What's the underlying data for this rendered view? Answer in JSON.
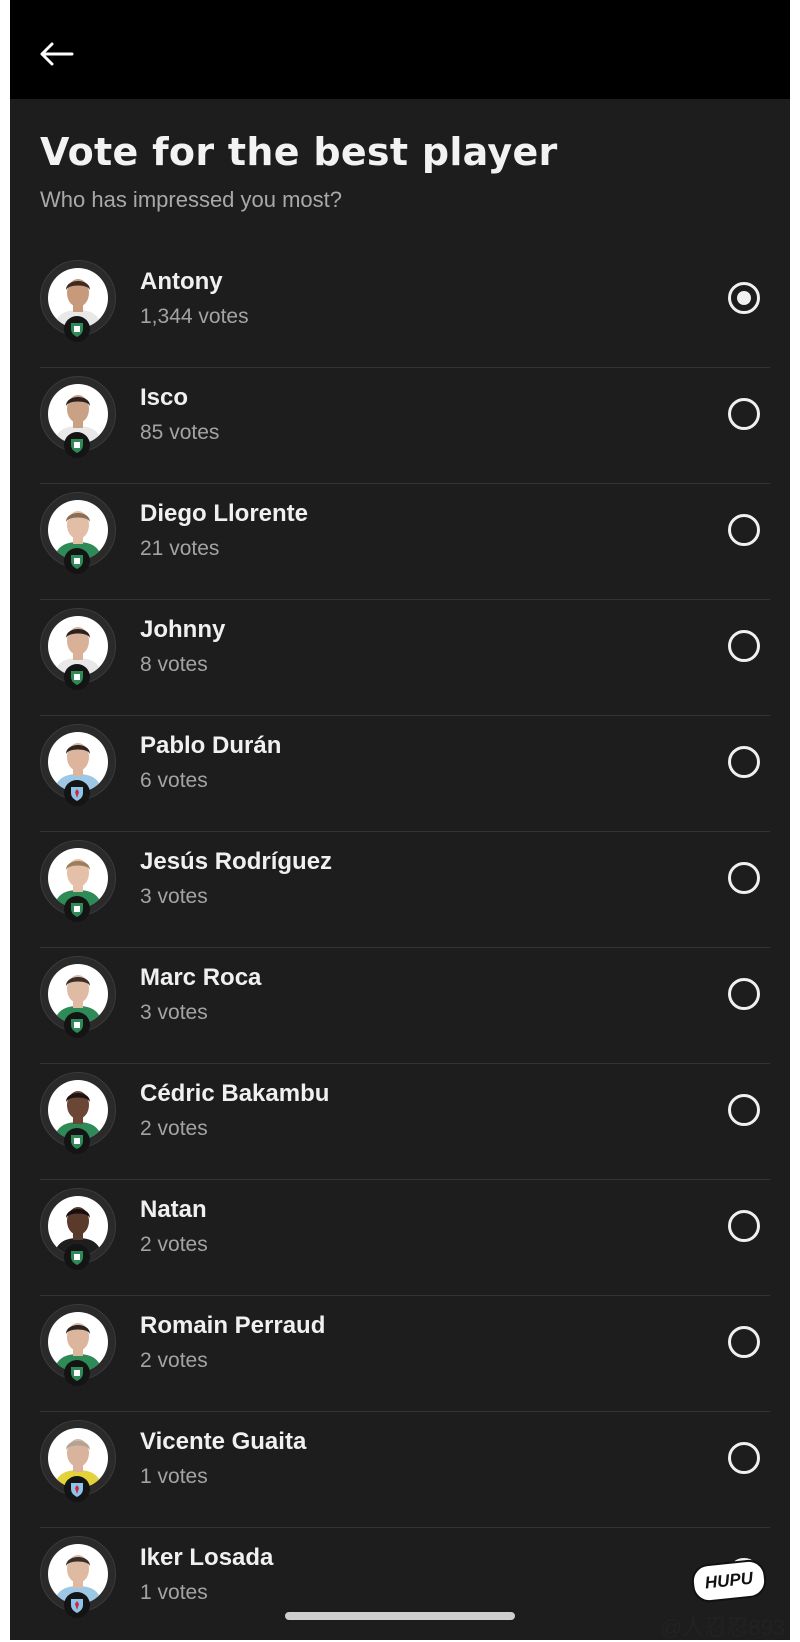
{
  "header": {
    "back_icon": "arrow-left-icon"
  },
  "poll": {
    "title": "Vote for the best player",
    "subtitle": "Who has impressed you most?"
  },
  "players": [
    {
      "name": "Antony",
      "votes": "1,344 votes",
      "selected": true,
      "skin": "#c89a7c",
      "hair": "#3b2b22",
      "shirt": "#e8e8e8",
      "team": "betis"
    },
    {
      "name": "Isco",
      "votes": "85 votes",
      "selected": false,
      "skin": "#c9a184",
      "hair": "#2b2220",
      "shirt": "#e8e8e8",
      "team": "betis"
    },
    {
      "name": "Diego Llorente",
      "votes": "21 votes",
      "selected": false,
      "skin": "#e2bea6",
      "hair": "#8a6d55",
      "shirt": "#2e8b57",
      "team": "betis"
    },
    {
      "name": "Johnny",
      "votes": "8 votes",
      "selected": false,
      "skin": "#d8b198",
      "hair": "#2a2220",
      "shirt": "#e8e8e8",
      "team": "betis"
    },
    {
      "name": "Pablo Durán",
      "votes": "6 votes",
      "selected": false,
      "skin": "#ddb49c",
      "hair": "#2f2622",
      "shirt": "#9cc8e6",
      "team": "celta"
    },
    {
      "name": "Jesús Rodríguez",
      "votes": "3 votes",
      "selected": false,
      "skin": "#e4c0a8",
      "hair": "#9b7f5c",
      "shirt": "#2e8b57",
      "team": "betis"
    },
    {
      "name": "Marc Roca",
      "votes": "3 votes",
      "selected": false,
      "skin": "#dfbba3",
      "hair": "#3a302b",
      "shirt": "#2e8b57",
      "team": "betis"
    },
    {
      "name": "Cédric Bakambu",
      "votes": "2 votes",
      "selected": false,
      "skin": "#6b4634",
      "hair": "#1c1412",
      "shirt": "#2e8b57",
      "team": "betis"
    },
    {
      "name": "Natan",
      "votes": "2 votes",
      "selected": false,
      "skin": "#5a3a2a",
      "hair": "#161010",
      "shirt": "#1e1e1e",
      "team": "betis"
    },
    {
      "name": "Romain Perraud",
      "votes": "2 votes",
      "selected": false,
      "skin": "#dcb59d",
      "hair": "#2b2420",
      "shirt": "#2e8b57",
      "team": "betis"
    },
    {
      "name": "Vicente Guaita",
      "votes": "1 votes",
      "selected": false,
      "skin": "#d9b39b",
      "hair": "#b0a595",
      "shirt": "#e3d23a",
      "team": "celta"
    },
    {
      "name": "Iker Losada",
      "votes": "1 votes",
      "selected": false,
      "skin": "#dfbaa2",
      "hair": "#3a2f28",
      "shirt": "#9cc8e6",
      "team": "celta"
    }
  ],
  "colors": {
    "background": "#1d1d1d",
    "topbar": "#000000",
    "text_primary": "#f0f0f0",
    "text_secondary": "#a3a3a3",
    "betis_green": "#2e8b57",
    "celta_blue": "#8ec3ea"
  },
  "watermark": {
    "logo": "HUPU",
    "text": "@人忍忍893"
  }
}
